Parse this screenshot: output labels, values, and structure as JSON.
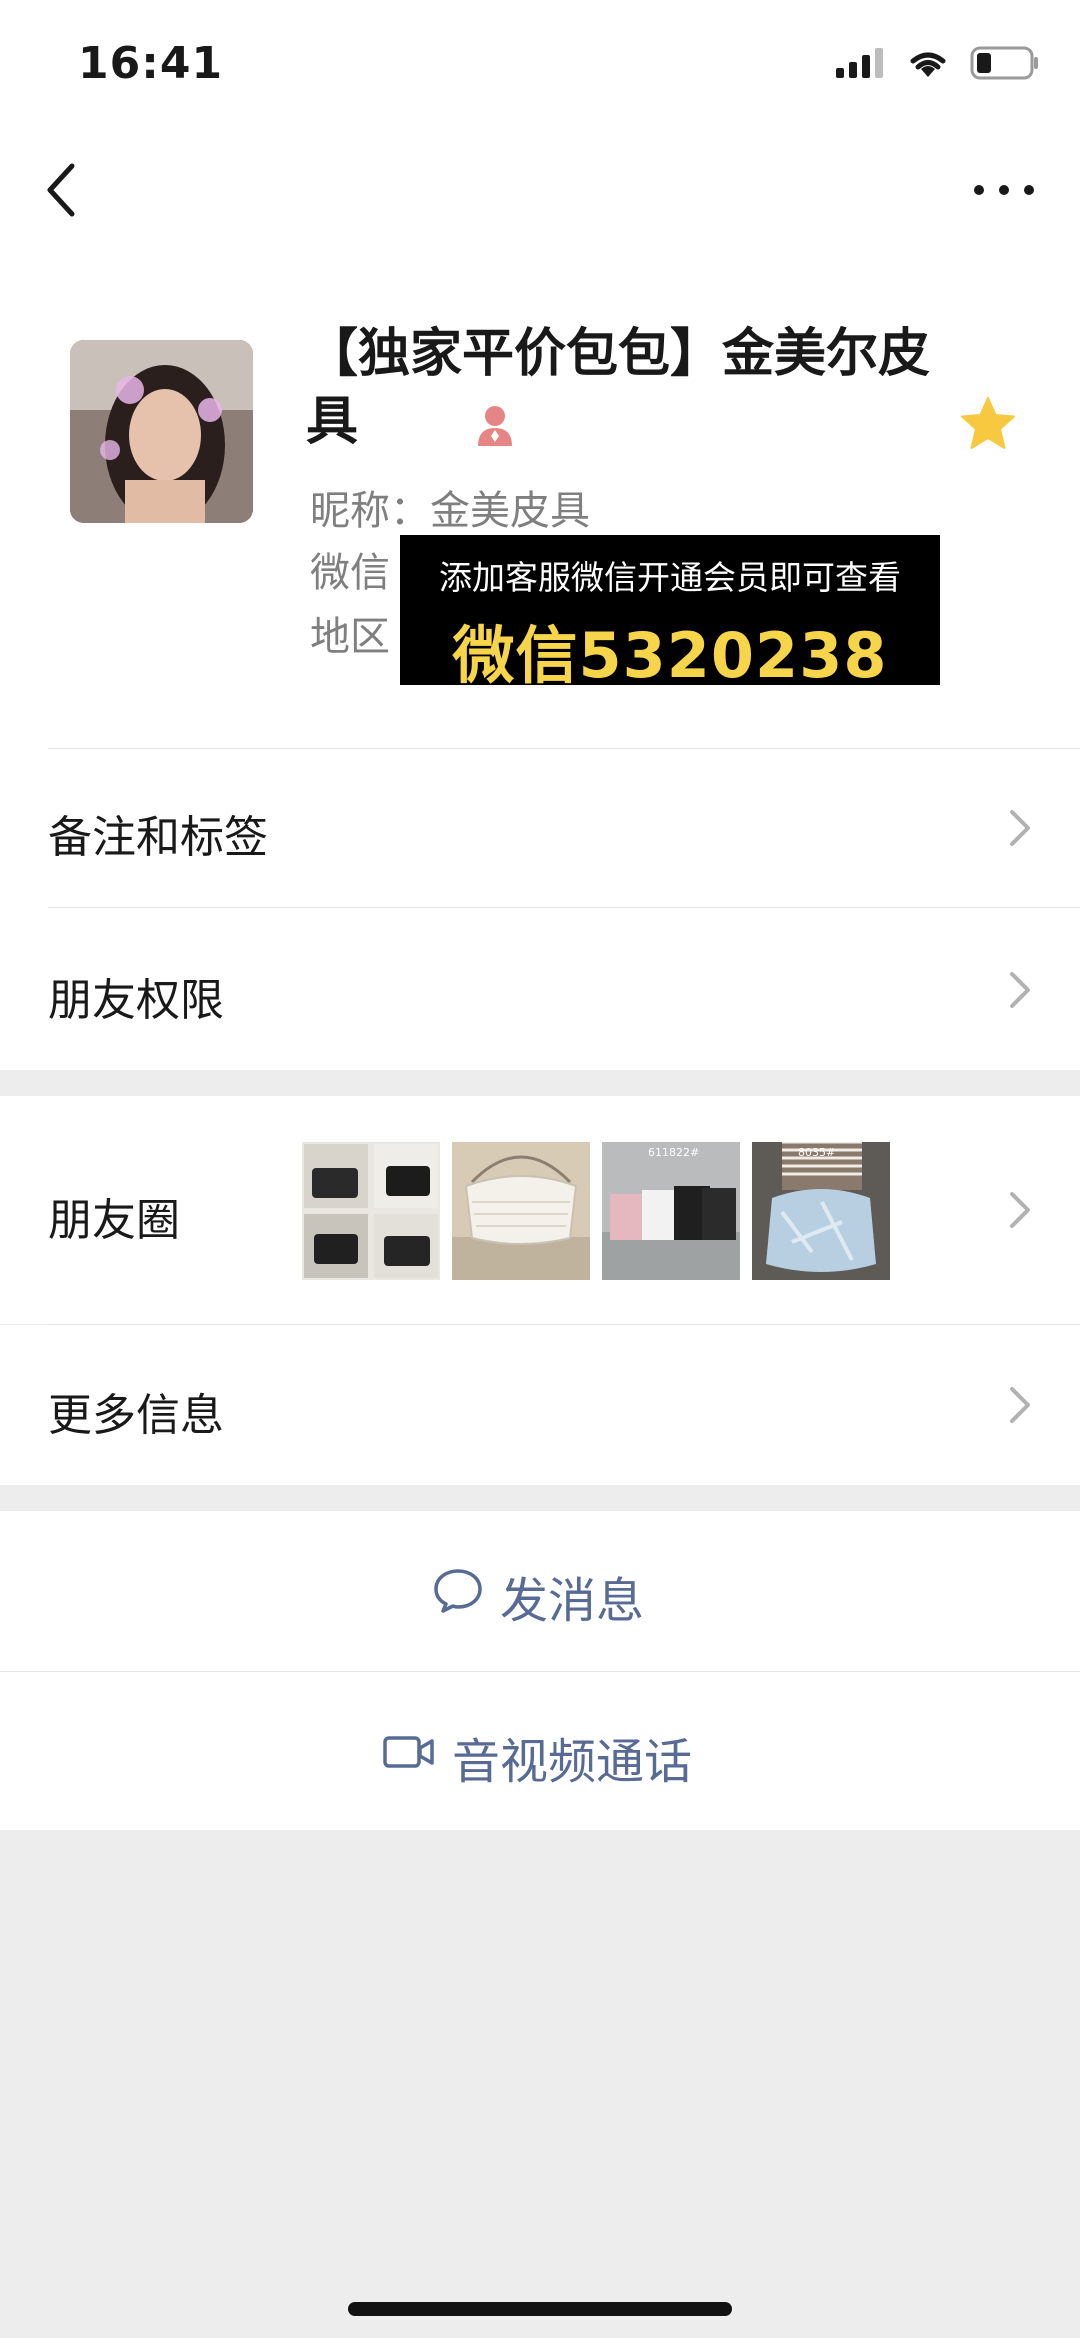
{
  "status_bar": {
    "time": "16:41"
  },
  "profile": {
    "name": "【独家平价包包】金美尔皮具",
    "nickname": "昵称：金美皮具",
    "wechat_id_prefix": "微信",
    "region_prefix": "地区",
    "starred": true,
    "gender": "female"
  },
  "promo_overlay": {
    "line1": "添加客服微信开通会员即可查看",
    "line2": "微信5320238",
    "accent": "#f7d54a"
  },
  "list": {
    "remarks_tags": "备注和标签",
    "friend_permissions": "朋友权限",
    "moments": "朋友圈",
    "more_info": "更多信息"
  },
  "moments_thumbs": [
    {
      "icon": "bag-collage-thumbnail"
    },
    {
      "icon": "white-crossbody-bag-thumbnail"
    },
    {
      "icon": "tote-bags-thumbnail",
      "label": "611822#"
    },
    {
      "icon": "denim-bag-thumbnail",
      "label": "8035#"
    }
  ],
  "actions": {
    "send_message": "发消息",
    "av_call": "音视频通话"
  },
  "colors": {
    "link_blue": "#576b95",
    "star_yellow": "#f8c840",
    "background": "#ededed"
  }
}
